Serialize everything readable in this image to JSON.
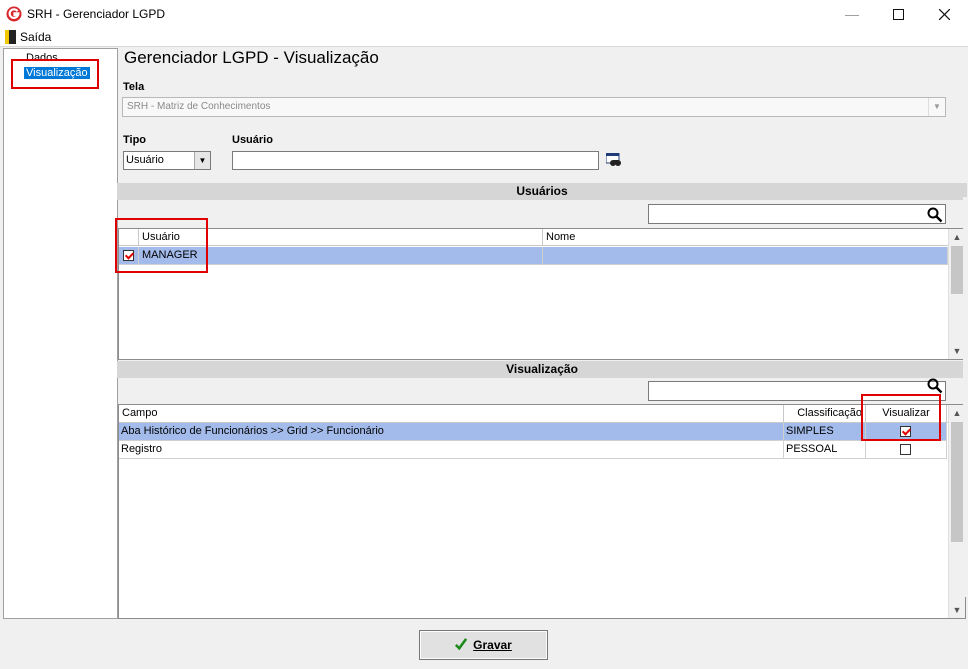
{
  "window": {
    "title": "SRH - Gerenciador LGPD"
  },
  "menu": {
    "exit_label": "Saída"
  },
  "tree": {
    "items": [
      "Dados",
      "Visualização"
    ]
  },
  "page": {
    "title": "Gerenciador LGPD - Visualização"
  },
  "form": {
    "tela_label": "Tela",
    "tela_value": "SRH - Matriz de Conhecimentos",
    "tipo_label": "Tipo",
    "tipo_value": "Usuário",
    "usuario_label": "Usuário",
    "usuario_value": ""
  },
  "users_section": {
    "header": "Usuários",
    "search_value": "",
    "columns": [
      "Usuário",
      "Nome"
    ],
    "rows": [
      {
        "checked": true,
        "usuario": "MANAGER",
        "nome": ""
      }
    ]
  },
  "visualization_section": {
    "header": "Visualização",
    "search_value": "",
    "columns": [
      "Campo",
      "Classificação",
      "Visualizar"
    ],
    "rows": [
      {
        "campo": "Aba Histórico de Funcionários >> Grid >> Funcionário",
        "classificacao": "SIMPLES",
        "visualizar": true
      },
      {
        "campo": "Registro",
        "classificacao": "PESSOAL",
        "visualizar": false
      }
    ]
  },
  "footer": {
    "save_label": "Gravar"
  },
  "icons": {
    "app": "srh-logo-icon",
    "exit": "exit-door-icon",
    "lookup": "lookup-binoculars-icon",
    "search": "search-icon",
    "save": "check-icon"
  },
  "colors": {
    "selection": "#a3bbea",
    "tree_selection": "#0078d7",
    "highlight": "#e00000",
    "section_header": "#d6d6d6"
  }
}
